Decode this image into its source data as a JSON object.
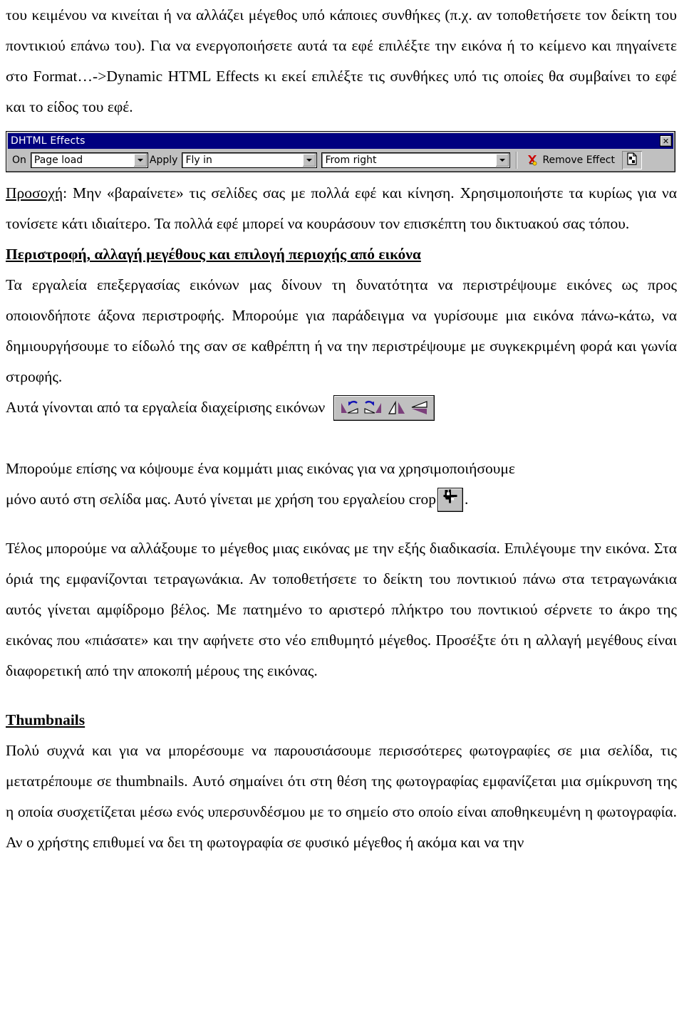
{
  "document": {
    "paragraphs": {
      "p1": "του κειμένου να κινείται ή να αλλάζει μέγεθος υπό κάποιες συνθήκες (π.χ. αν τοποθετήσετε τον δείκτη του ποντικιού επάνω του). Για να ενεργοποιήσετε αυτά τα εφέ επιλέξτε την εικόνα ή το κείμενο και πηγαίνετε στο Format…->Dynamic HTML Effects κι εκεί επιλέξτε τις συνθήκες υπό τις οποίες θα συμβαίνει το εφέ και το είδος του εφέ.",
      "p2_label": "Προσοχή",
      "p2_colon": ":",
      "p2_rest": " Μην «βαραίνετε» τις σελίδες σας με πολλά εφέ και κίνηση. Χρησιμοποιήστε τα κυρίως για να τονίσετε κάτι ιδιαίτερο. Τα πολλά εφέ μπορεί να κουράσουν τον επισκέπτη του δικτυακού σας τόπου.",
      "heading_rotate": "Περιστροφή, αλλαγή μεγέθους και επιλογή περιοχής από εικόνα",
      "p3": "Τα εργαλεία επεξεργασίας εικόνων μας δίνουν τη δυνατότητα να περιστρέψουμε εικόνες ως προς οποιονδήποτε άξονα περιστροφής. Μπορούμε για παράδειγμα να γυρίσουμε μια εικόνα πάνω-κάτω, να δημιουργήσουμε το είδωλό της σαν σε καθρέπτη ή να την περιστρέψουμε με συγκεκριμένη φορά και γωνία στροφής.",
      "p4_before_toolbar": "Αυτά γίνονται από τα εργαλεία διαχείρισης εικόνων",
      "p5_line1": "Μπορούμε επίσης να κόψουμε ένα κομμάτι μιας εικόνας για να χρησιμοποιήσουμε",
      "p5_before_crop": "μόνο αυτό στη σελίδα μας. Αυτό γίνεται με χρήση του εργαλείου crop",
      "p5_after_crop": ".",
      "p6": "Τέλος μπορούμε να αλλάξουμε το μέγεθος μιας εικόνας με την εξής διαδικασία. Επιλέγουμε την εικόνα. Στα όριά της εμφανίζονται τετραγωνάκια. Αν τοποθετήσετε το δείκτη του ποντικιού πάνω στα τετραγωνάκια αυτός γίνεται αμφίδρομο βέλος. Με πατημένο το αριστερό πλήκτρο του ποντικιού σέρνετε το άκρο της εικόνας που «πιάσατε» και την αφήνετε στο νέο επιθυμητό μέγεθος. Προσέξτε ότι η αλλαγή μεγέθους είναι διαφορετική από την αποκοπή μέρους της εικόνας.",
      "heading_thumbnails": "Thumbnails",
      "p7": "Πολύ συχνά και για να μπορέσουμε να παρουσιάσουμε περισσότερες φωτογραφίες σε μια σελίδα, τις μετατρέπουμε σε thumbnails. Αυτό σημαίνει ότι στη θέση της φωτογραφίας εμφανίζεται μια σμίκρυνση της η οποία συσχετίζεται μέσω ενός υπερσυνδέσμου με το σημείο στο οποίο είναι αποθηκευμένη η φωτογραφία. Αν ο χρήστης επιθυμεί να δει τη φωτογραφία σε φυσικό μέγεθος ή ακόμα και να την"
    }
  },
  "dhtml_toolbar": {
    "title": "DHTML Effects",
    "close_label": "✕",
    "on_label": "On",
    "on_value": "Page load",
    "apply_label": "Apply",
    "apply_value": "Fly in",
    "direction_value": "From right",
    "remove_effect_label": "Remove Effect",
    "icons": {
      "close": "close-icon",
      "on_dropdown": "chevron-down-icon",
      "apply_dropdown": "chevron-down-icon",
      "direction_dropdown": "chevron-down-icon",
      "remove_effect": "remove-effect-x-icon",
      "highlight_effects": "highlight-dynamic-html-effects-icon"
    },
    "colors": {
      "titlebar": "#000080",
      "titlebar_text": "#ffffff",
      "face": "#c0c0c0",
      "field": "#ffffff",
      "remove_x": "#cc0000"
    }
  },
  "image_tools_toolbar": {
    "buttons": [
      {
        "name": "rotate-left-button",
        "tooltip": "Rotate Left"
      },
      {
        "name": "rotate-right-button",
        "tooltip": "Rotate Right"
      },
      {
        "name": "flip-horizontal-button",
        "tooltip": "Flip Horizontal"
      },
      {
        "name": "flip-vertical-button",
        "tooltip": "Flip Vertical"
      }
    ],
    "colors": {
      "shape": "#7b3f7b",
      "arrow": "#1414b4",
      "face": "#c0c0c0"
    }
  },
  "crop_tool": {
    "name": "crop-button",
    "label": "crop",
    "colors": {
      "glyph": "#000000",
      "face": "#c0c0c0"
    }
  }
}
